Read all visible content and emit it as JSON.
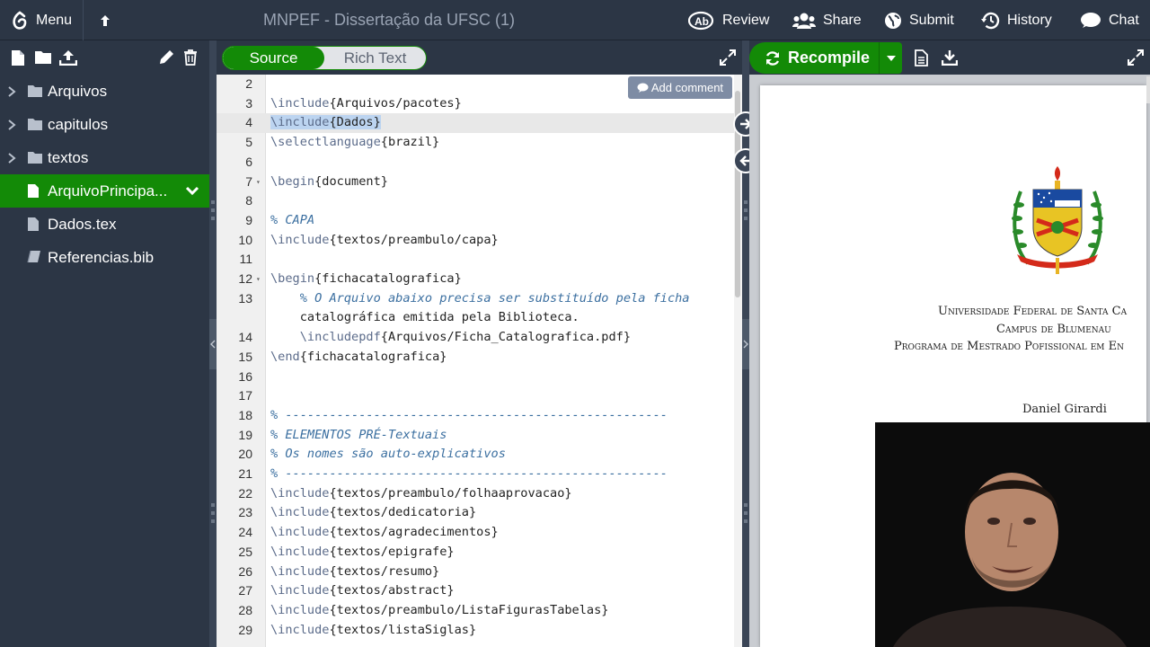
{
  "topbar": {
    "menu_label": "Menu",
    "project_title": "MNPEF - Dissertação da UFSC (1)",
    "review_label": "Review",
    "share_label": "Share",
    "submit_label": "Submit",
    "history_label": "History",
    "chat_label": "Chat"
  },
  "file_tree": {
    "items": [
      {
        "label": "Arquivos",
        "type": "folder"
      },
      {
        "label": "capitulos",
        "type": "folder"
      },
      {
        "label": "textos",
        "type": "folder"
      },
      {
        "label": "ArquivoPrincipa...",
        "type": "file",
        "selected": true
      },
      {
        "label": "Dados.tex",
        "type": "file"
      },
      {
        "label": "Referencias.bib",
        "type": "bib"
      }
    ]
  },
  "editor": {
    "source_label": "Source",
    "rich_text_label": "Rich Text",
    "add_comment_label": "Add comment",
    "lines": [
      {
        "n": "2",
        "text": ""
      },
      {
        "n": "3",
        "text": "\\include{Arquivos/pacotes}"
      },
      {
        "n": "4",
        "text": "\\include{Dados}"
      },
      {
        "n": "5",
        "text": "\\selectlanguage{brazil}"
      },
      {
        "n": "6",
        "text": ""
      },
      {
        "n": "7",
        "text": "\\begin{document}"
      },
      {
        "n": "8",
        "text": ""
      },
      {
        "n": "9",
        "text": "% CAPA"
      },
      {
        "n": "10",
        "text": "\\include{textos/preambulo/capa}"
      },
      {
        "n": "11",
        "text": ""
      },
      {
        "n": "12",
        "text": "\\begin{fichacatalografica}"
      },
      {
        "n": "13",
        "text": "    % O Arquivo abaixo precisa ser substituído pela ficha"
      },
      {
        "n": "",
        "text": "    catalográfica emitida pela Biblioteca."
      },
      {
        "n": "14",
        "text": "    \\includepdf{Arquivos/Ficha_Catalografica.pdf}"
      },
      {
        "n": "15",
        "text": "\\end{fichacatalografica}"
      },
      {
        "n": "16",
        "text": ""
      },
      {
        "n": "17",
        "text": ""
      },
      {
        "n": "18",
        "text": "% ----------------------------------------------------"
      },
      {
        "n": "19",
        "text": "% ELEMENTOS PRÉ-Textuais"
      },
      {
        "n": "20",
        "text": "% Os nomes são auto-explicativos"
      },
      {
        "n": "21",
        "text": "% ----------------------------------------------------"
      },
      {
        "n": "22",
        "text": "\\include{textos/preambulo/folhaaprovacao}"
      },
      {
        "n": "23",
        "text": "\\include{textos/dedicatoria}"
      },
      {
        "n": "24",
        "text": "\\include{textos/agradecimentos}"
      },
      {
        "n": "25",
        "text": "\\include{textos/epigrafe}"
      },
      {
        "n": "26",
        "text": "\\include{textos/resumo}"
      },
      {
        "n": "27",
        "text": "\\include{textos/abstract}"
      },
      {
        "n": "28",
        "text": "\\include{textos/preambulo/ListaFigurasTabelas}"
      },
      {
        "n": "29",
        "text": "\\include{textos/listaSiglas}"
      }
    ]
  },
  "pdf": {
    "recompile_label": "Recompile",
    "university": "Universidade Federal de Santa Ca",
    "campus": "Campus de Blumenau",
    "program": "Programa de Mestrado Pofissional em En",
    "author": "Daniel Girardi"
  },
  "colors": {
    "accent_green": "#138a07",
    "toolbar_bg": "#2c3645"
  }
}
